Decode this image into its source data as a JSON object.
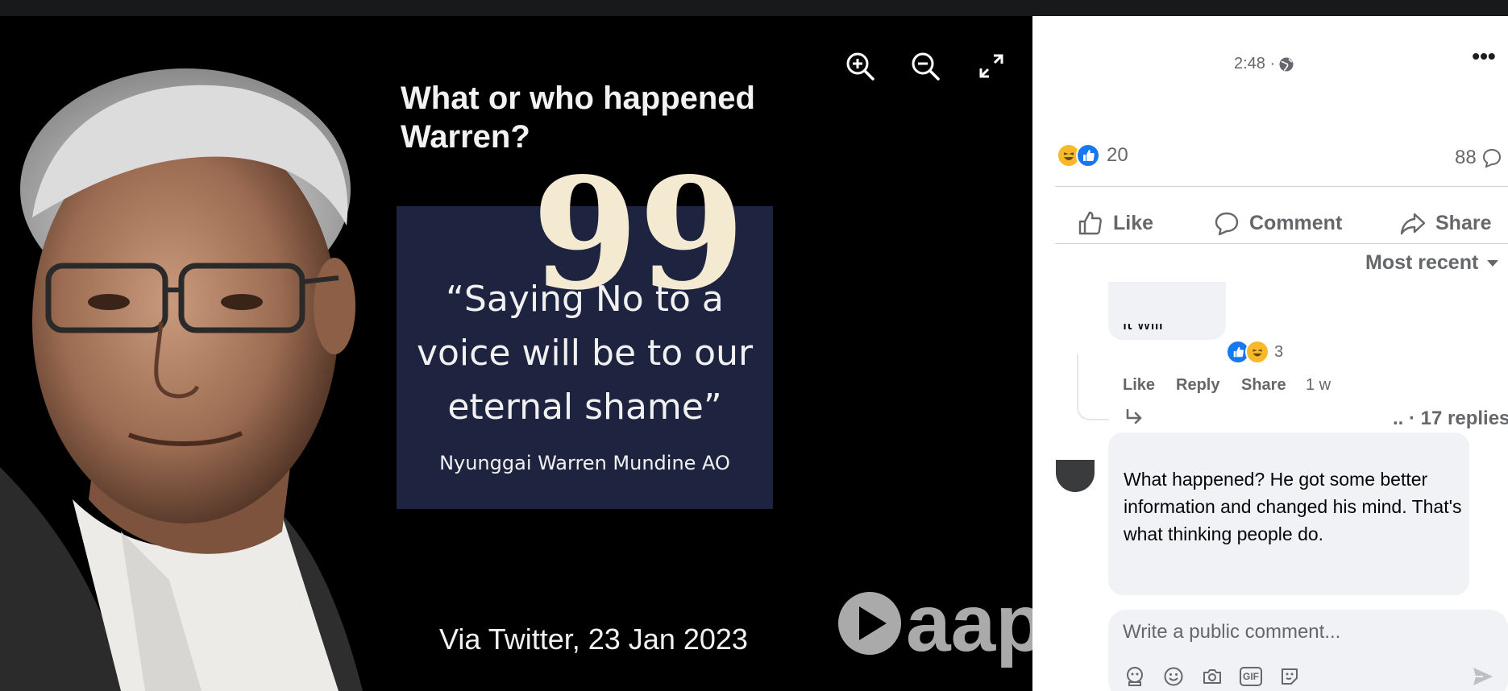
{
  "photo": {
    "title": "What or who happened Warren?",
    "quote_marks": "99",
    "quote": "“Saying No to a voice will be to our eternal shame”",
    "quote_author": "Nyunggai Warren Mundine AO",
    "footer": "Via Twitter, 23 Jan 2023",
    "watermark": "aap"
  },
  "viewer_controls": [
    "zoom-in-icon",
    "zoom-out-icon",
    "fullscreen-icon"
  ],
  "post": {
    "time": "2:48 ·",
    "more_label": "•••",
    "reaction_count": "20",
    "comment_count": "88",
    "actions": {
      "like": "Like",
      "comment": "Comment",
      "share": "Share"
    },
    "sort_label": "Most recent"
  },
  "comments": {
    "first": {
      "text_fragment": "it will",
      "reaction_count": "3",
      "like": "Like",
      "reply": "Reply",
      "share": "Share",
      "time": "1 w",
      "replies_label": ".. · 17 replies"
    },
    "second": {
      "text": "What happened? He got some better information and changed his mind. That's what thinking people do."
    }
  },
  "composer": {
    "placeholder": "Write a public comment..."
  },
  "colors": {
    "like_blue": "#1877f2",
    "haha_yellow": "#f7b928",
    "secondary_text": "#65676b",
    "bubble_bg": "#f0f2f5",
    "quote_box_bg": "#1e2340"
  }
}
